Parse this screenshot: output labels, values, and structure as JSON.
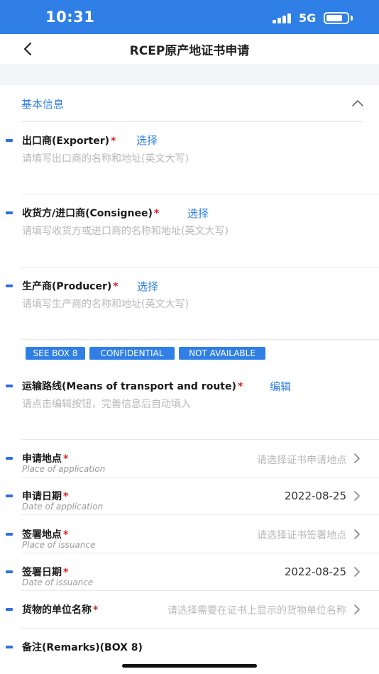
{
  "status_bar": {
    "time": "10:31",
    "network": "5G",
    "battery_level": 0.8
  },
  "nav": {
    "title": "RCEP原产地证书申请"
  },
  "section": {
    "title": "基本信息"
  },
  "fields": {
    "exporter": {
      "label": "出口商(Exporter)",
      "required": "*",
      "action": "选择",
      "placeholder": "请填写出口商的名称和地址(英文大写)"
    },
    "consignee": {
      "label": "收货方/进口商(Consignee)",
      "required": "*",
      "action": "选择",
      "placeholder": "请填写收货方或进口商的名称和地址(英文大写)"
    },
    "producer": {
      "label": "生产商(Producer)",
      "required": "*",
      "action": "选择",
      "placeholder": "请填写生产商的名称和地址(英文大写)"
    },
    "producer_tags": [
      "SEE BOX 8",
      "CONFIDENTIAL",
      "NOT AVAILABLE"
    ],
    "transport": {
      "label": "运输路线(Means of transport and route)",
      "required": "*",
      "action": "编辑",
      "placeholder": "请点击编辑按钮，完善信息后自动填入"
    }
  },
  "rows": {
    "place_of_application": {
      "label": "申请地点",
      "required": "*",
      "sub": "Place of application",
      "value": "请选择证书申请地点"
    },
    "date_of_application": {
      "label": "申请日期",
      "required": "*",
      "sub": "Date of application",
      "value": "2022-08-25"
    },
    "place_of_issuance": {
      "label": "签署地点",
      "required": "*",
      "sub": "Place of issuance",
      "value": "请选择证书签署地点"
    },
    "date_of_issuance": {
      "label": "签署日期",
      "required": "*",
      "sub": "Date of issuance",
      "value": "2022-08-25"
    },
    "goods_unit_name": {
      "label": "货物的单位名称",
      "required": "*",
      "value": "请选择需要在证书上显示的货物单位名称"
    },
    "remarks": {
      "label": "备注(Remarks)(BOX 8)"
    }
  },
  "colors": {
    "accent": "#2f7fe6",
    "required": "#e02020",
    "placeholder": "#b8b8b8"
  }
}
